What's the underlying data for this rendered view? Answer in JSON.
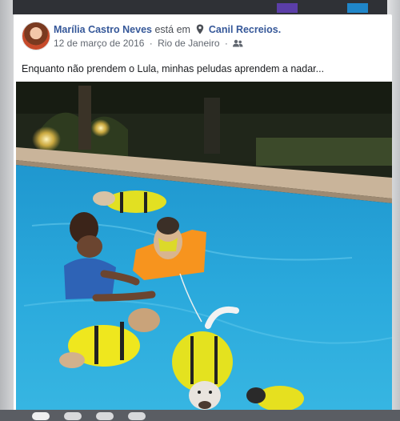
{
  "post": {
    "author": "Marília Castro Neves",
    "verb": "está em",
    "place": "Canil Recreios.",
    "date": "12 de março de 2016",
    "separator": "·",
    "location": "Rio de Janeiro",
    "separator2": "·",
    "text": "Enquanto não prendem o Lula, minhas peludas aprendem a nadar..."
  },
  "icons": {
    "location_pin": "map-pin-icon",
    "audience": "friends-icon"
  },
  "colors": {
    "link": "#365899",
    "meta": "#616770",
    "pool_water": "#27a6d8"
  }
}
